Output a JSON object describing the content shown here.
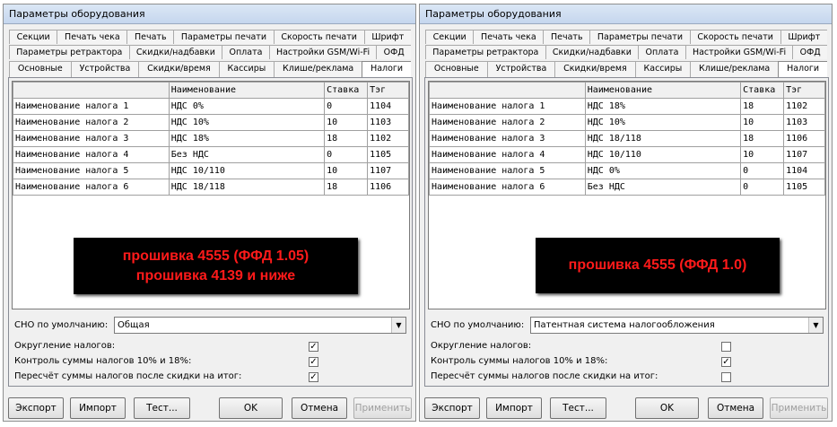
{
  "left": {
    "title": "Параметры оборудования",
    "tabs_row1": [
      "Секции",
      "Печать чека",
      "Печать",
      "Параметры печати",
      "Скорость печати",
      "Шрифт"
    ],
    "tabs_row2": [
      "Параметры ретрактора",
      "Скидки/надбавки",
      "Оплата",
      "Настройки GSM/Wi-Fi",
      "ОФД"
    ],
    "tabs_row3": [
      "Основные",
      "Устройства",
      "Скидки/время",
      "Кассиры",
      "Клише/реклама",
      "Налоги"
    ],
    "active_tab": "Налоги",
    "grid": {
      "headers": [
        "Наименование",
        "Ставка",
        "Тэг"
      ],
      "rows": [
        {
          "label": "Наименование налога 1",
          "name": "НДС 0%",
          "rate": "0",
          "tag": "1104"
        },
        {
          "label": "Наименование налога 2",
          "name": "НДС 10%",
          "rate": "10",
          "tag": "1103"
        },
        {
          "label": "Наименование налога 3",
          "name": "НДС 18%",
          "rate": "18",
          "tag": "1102"
        },
        {
          "label": "Наименование налога 4",
          "name": "Без НДС",
          "rate": "0",
          "tag": "1105"
        },
        {
          "label": "Наименование налога 5",
          "name": "НДС 10/110",
          "rate": "10",
          "tag": "1107"
        },
        {
          "label": "Наименование налога 6",
          "name": "НДС 18/118",
          "rate": "18",
          "tag": "1106"
        }
      ]
    },
    "banner": [
      "прошивка 4555 (ФФД 1.05)",
      "прошивка 4139 и ниже"
    ],
    "sno_label": "СНО по умолчанию:",
    "sno_value": "Общая",
    "options": [
      {
        "label": "Округление налогов:",
        "checked": true
      },
      {
        "label": "Контроль суммы налогов 10% и 18%:",
        "checked": true
      },
      {
        "label": "Пересчёт суммы налогов после скидки на итог:",
        "checked": true
      }
    ],
    "buttons": {
      "export": "Экспорт",
      "import": "Импорт",
      "test": "Тест...",
      "ok": "OK",
      "cancel": "Отмена",
      "apply": "Применить"
    }
  },
  "right": {
    "title": "Параметры оборудования",
    "tabs_row1": [
      "Секции",
      "Печать чека",
      "Печать",
      "Параметры печати",
      "Скорость печати",
      "Шрифт"
    ],
    "tabs_row2": [
      "Параметры ретрактора",
      "Скидки/надбавки",
      "Оплата",
      "Настройки GSM/Wi-Fi",
      "ОФД"
    ],
    "tabs_row3": [
      "Основные",
      "Устройства",
      "Скидки/время",
      "Кассиры",
      "Клише/реклама",
      "Налоги"
    ],
    "active_tab": "Налоги",
    "grid": {
      "headers": [
        "Наименование",
        "Ставка",
        "Тэг"
      ],
      "rows": [
        {
          "label": "Наименование налога 1",
          "name": "НДС 18%",
          "rate": "18",
          "tag": "1102"
        },
        {
          "label": "Наименование налога 2",
          "name": "НДС 10%",
          "rate": "10",
          "tag": "1103"
        },
        {
          "label": "Наименование налога 3",
          "name": "НДС 18/118",
          "rate": "18",
          "tag": "1106"
        },
        {
          "label": "Наименование налога 4",
          "name": "НДС 10/110",
          "rate": "10",
          "tag": "1107"
        },
        {
          "label": "Наименование налога 5",
          "name": "НДС 0%",
          "rate": "0",
          "tag": "1104"
        },
        {
          "label": "Наименование налога 6",
          "name": "Без НДС",
          "rate": "0",
          "tag": "1105"
        }
      ]
    },
    "banner": [
      "прошивка 4555 (ФФД 1.0)"
    ],
    "sno_label": "СНО по умолчанию:",
    "sno_value": "Патентная система налогообложения",
    "options": [
      {
        "label": "Округление налогов:",
        "checked": false
      },
      {
        "label": "Контроль суммы налогов 10% и 18%:",
        "checked": true
      },
      {
        "label": "Пересчёт суммы налогов после скидки на итог:",
        "checked": false
      }
    ],
    "buttons": {
      "export": "Экспорт",
      "import": "Импорт",
      "test": "Тест...",
      "ok": "OK",
      "cancel": "Отмена",
      "apply": "Применить"
    }
  },
  "colors": {
    "banner_bg": "#000000",
    "banner_text": "#ff1a1a",
    "window_bg": "#f0f0f0"
  }
}
